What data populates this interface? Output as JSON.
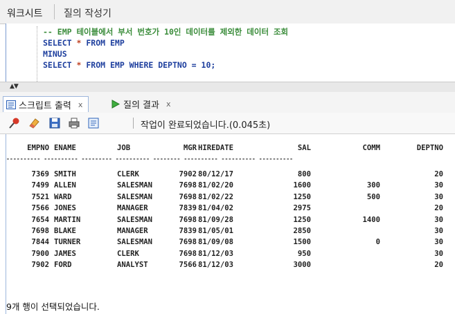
{
  "tabs": {
    "worksheet": "워크시트",
    "query_builder": "질의 작성기"
  },
  "editor": {
    "comment": "-- EMP 테이블에서 부서 번호가 10인 데이터를 제외한 데이터 조회",
    "line2_select": "SELECT",
    "line2_star": "*",
    "line2_from": "FROM EMP",
    "line3": "MINUS",
    "line4_select": "SELECT",
    "line4_star": "*",
    "line4_from": "FROM EMP WHERE DEPTNO = 10;"
  },
  "pane_tabs": {
    "script_output": "스크립트 출력",
    "query_result": "질의 결과",
    "close": "x"
  },
  "toolbar": {
    "status": "작업이 완료되었습니다.(0.045초)"
  },
  "results": {
    "headers": [
      "EMPNO",
      "ENAME",
      "JOB",
      "MGR",
      "HIREDATE",
      "SAL",
      "COMM",
      "DEPTNO"
    ],
    "separator": "---------- ---------- --------- ---------- -------- ---------- ---------- ----------",
    "rows": [
      [
        "7369",
        "SMITH",
        "CLERK",
        "7902",
        "80/12/17",
        "800",
        "",
        "20"
      ],
      [
        "7499",
        "ALLEN",
        "SALESMAN",
        "7698",
        "81/02/20",
        "1600",
        "300",
        "30"
      ],
      [
        "7521",
        "WARD",
        "SALESMAN",
        "7698",
        "81/02/22",
        "1250",
        "500",
        "30"
      ],
      [
        "7566",
        "JONES",
        "MANAGER",
        "7839",
        "81/04/02",
        "2975",
        "",
        "20"
      ],
      [
        "7654",
        "MARTIN",
        "SALESMAN",
        "7698",
        "81/09/28",
        "1250",
        "1400",
        "30"
      ],
      [
        "7698",
        "BLAKE",
        "MANAGER",
        "7839",
        "81/05/01",
        "2850",
        "",
        "30"
      ],
      [
        "7844",
        "TURNER",
        "SALESMAN",
        "7698",
        "81/09/08",
        "1500",
        "0",
        "30"
      ],
      [
        "7900",
        "JAMES",
        "CLERK",
        "7698",
        "81/12/03",
        "950",
        "",
        "30"
      ],
      [
        "7902",
        "FORD",
        "ANALYST",
        "7566",
        "81/12/03",
        "3000",
        "",
        "20"
      ]
    ],
    "footer": "9개 행이 선택되었습니다."
  }
}
